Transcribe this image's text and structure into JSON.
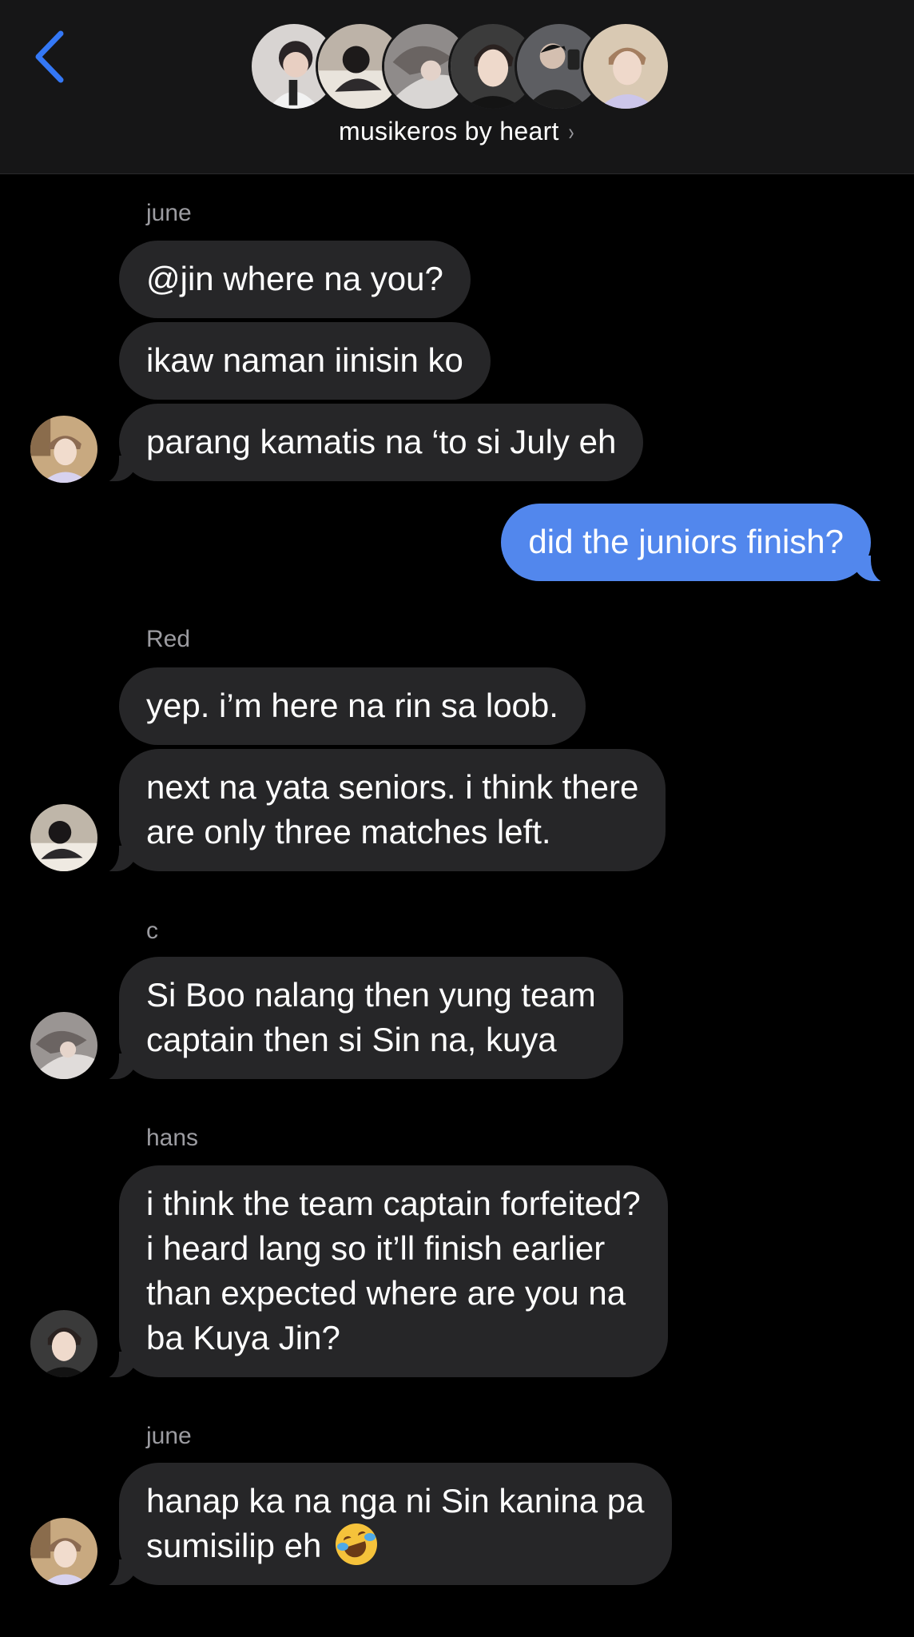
{
  "header": {
    "back_icon": "chevron-left-icon",
    "group_name": "musikeros by heart",
    "group_chevron": "›",
    "members": [
      "member-1",
      "member-2",
      "member-3",
      "member-4",
      "member-5",
      "member-6"
    ],
    "accent_color": "#3478f6"
  },
  "messages": [
    {
      "sender": "june",
      "texts": [
        "@jin where na you?",
        "ikaw naman iinisin ko",
        "parang kamatis na ‘to si July eh"
      ]
    },
    {
      "outgoing": true,
      "texts": [
        "did the juniors finish?"
      ]
    },
    {
      "sender": "Red",
      "texts": [
        "yep. i’m here na rin sa loob.",
        "next na yata seniors. i think there",
        "are only three matches left."
      ]
    },
    {
      "sender": "c",
      "texts": [
        "Si Boo nalang then yung team",
        "captain then si Sin na, kuya"
      ]
    },
    {
      "sender": "hans",
      "texts": [
        "i think the team captain forfeited?",
        "i heard lang so it’ll finish earlier",
        "than expected where are you na",
        "ba Kuya Jin?"
      ]
    },
    {
      "sender": "june",
      "texts": [
        "hanap ka na nga ni Sin kanina pa",
        "sumisilip eh"
      ],
      "emoji": "rolling-on-floor-laughing-emoji"
    }
  ],
  "colors": {
    "incoming_bubble": "#262628",
    "outgoing_bubble": "#5287ed",
    "sender_label": "#9c9ca1",
    "background": "#000000"
  }
}
